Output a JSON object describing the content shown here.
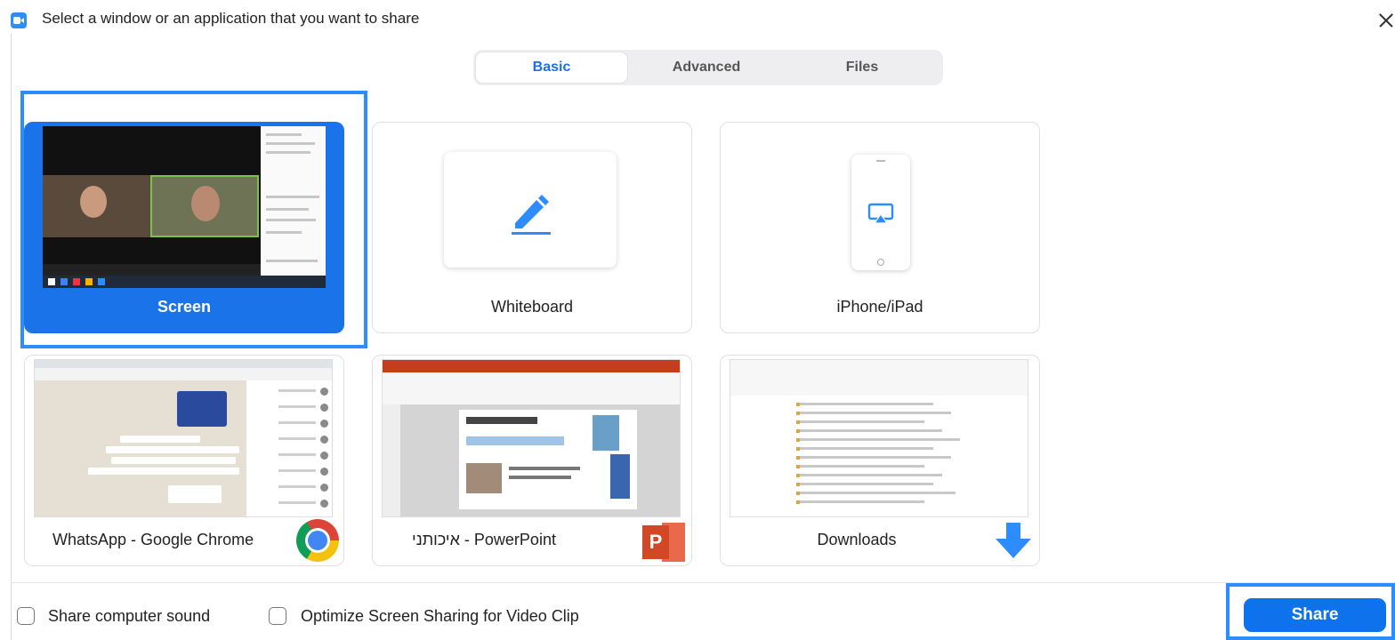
{
  "window": {
    "title": "Select a window or an application that you want to share",
    "accent_color": "#2d8cff",
    "selected_color": "#1a73e8"
  },
  "tabs": [
    {
      "label": "Basic",
      "active": true
    },
    {
      "label": "Advanced",
      "active": false
    },
    {
      "label": "Files",
      "active": false
    }
  ],
  "options": [
    {
      "label": "Screen",
      "selected": true,
      "icon": "screen-preview"
    },
    {
      "label": "Whiteboard",
      "selected": false,
      "icon": "pen-icon"
    },
    {
      "label": "iPhone/iPad",
      "selected": false,
      "icon": "airplay-icon"
    },
    {
      "label": "WhatsApp - Google Chrome",
      "selected": false,
      "icon": "chrome-icon"
    },
    {
      "label": "איכותני - PowerPoint",
      "selected": false,
      "icon": "powerpoint-icon"
    },
    {
      "label": "Downloads",
      "selected": false,
      "icon": "download-arrow-icon"
    }
  ],
  "footer": {
    "share_sound_label": "Share computer sound",
    "share_sound_checked": false,
    "optimize_label": "Optimize Screen Sharing for Video Clip",
    "optimize_checked": false,
    "share_button": "Share"
  }
}
